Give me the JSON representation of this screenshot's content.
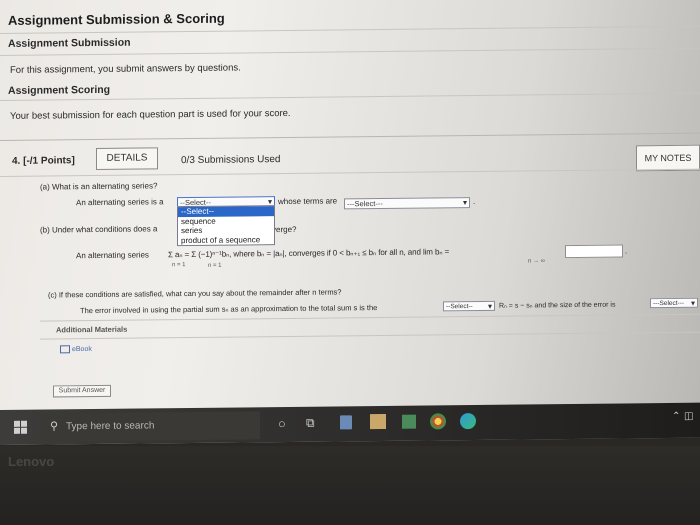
{
  "header": {
    "title": "Assignment Submission & Scoring",
    "submission_heading": "Assignment Submission",
    "submission_text": "For this assignment, you submit answers by questions.",
    "scoring_heading": "Assignment Scoring",
    "scoring_text": "Your best submission for each question part is used for your score."
  },
  "question": {
    "number_points": "4. [-/1 Points]",
    "details_label": "DETAILS",
    "submissions_used": "0/3 Submissions Used",
    "my_notes_label": "MY NOTES",
    "part_a_label": "(a) What is an alternating series?",
    "part_a_prefix": "An alternating series is a",
    "part_a_select1": "--Select--",
    "part_a_middle": "whose terms are",
    "part_a_select2": "---Select---",
    "part_a_period": ".",
    "part_b_label": "(b) Under what conditions does a",
    "part_b_suffix": "verge?",
    "part_b_sentence": "An alternating series",
    "part_b_formula": "Σ aₙ = Σ (−1)ⁿ⁻¹bₙ, where bₙ = |aₙ|, converges if 0 < bₙ₊₁ ≤ bₙ for all n, and lim bₙ =",
    "part_b_sub1": "n = 1",
    "part_b_sub2": "n = 1",
    "part_b_sub3": "n → ∞",
    "part_b_period": ".",
    "part_c_label": "(c) If these conditions are satisfied, what can you say about the remainder after n terms?",
    "part_c_text": "The error involved in using the partial sum sₙ as an approximation to the total sum s is the",
    "part_c_select1": "--Select--",
    "part_c_middle": "Rₙ = s − sₙ and the size of the error is",
    "part_c_select2": "---Select---",
    "additional_materials": "Additional Materials",
    "ebook_label": "eBook",
    "submit_label": "Submit Answer"
  },
  "dropdown": {
    "options": [
      "--Select--",
      "sequence",
      "series",
      "product of a sequence"
    ],
    "highlighted_index": 0
  },
  "taskbar": {
    "search_placeholder": "Type here to search"
  },
  "bezel": {
    "brand": "Lenovo"
  }
}
